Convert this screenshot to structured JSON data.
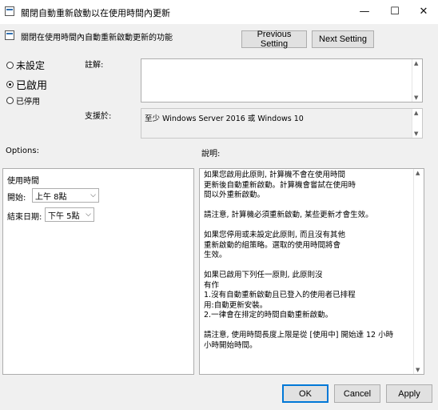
{
  "window": {
    "title": "關閉自動重新啟動以在使用時間內更新",
    "minimize_glyph": "—",
    "maximize_glyph": "☐",
    "close_glyph": "✕"
  },
  "header": {
    "policy_name": "關閉在使用時間內自動重新啟動更新的功能",
    "prev_button": "Previous Setting",
    "next_button": "Next Setting"
  },
  "state": {
    "options": [
      {
        "label": "未設定",
        "checked": false
      },
      {
        "label": "已啟用",
        "checked": true
      },
      {
        "label": "已停用",
        "checked": false
      }
    ]
  },
  "comment": {
    "label": "註解:",
    "value": ""
  },
  "supported": {
    "label": "支援於:",
    "value": "至少 Windows Server 2016 或 Windows 10"
  },
  "options_section": {
    "label": "Options:",
    "group_label": "使用時間",
    "start_label": "開始:",
    "start_value": "上午 8點",
    "end_label": "結束日期:",
    "end_value": "下午 5點"
  },
  "help": {
    "label": "說明:",
    "text": "如果您啟用此原則, 計算機不會在使用時間\n更新後自動重新啟動。計算機會嘗試在使用時\n間以外重新啟動。\n\n請注意, 計算機必須重新啟動, 某些更新才會生效。\n\n如果您停用或未設定此原則, 而且沒有其他\n重新啟動的組策略。選取的使用時間將會\n生效。\n\n如果已啟用下列任一原則, 此原則沒\n有作\n    1.沒有自動重新啟動且已登入的使用者已排程\n用:自動更新安裝。\n    2.一律會在排定的時間自動重新啟動。\n\n請注意, 使用時間長度上限是從 [使用中] 開始達 12 小時\n小時開始時間。"
  },
  "footer": {
    "ok": "OK",
    "cancel": "Cancel",
    "apply": "Apply"
  }
}
